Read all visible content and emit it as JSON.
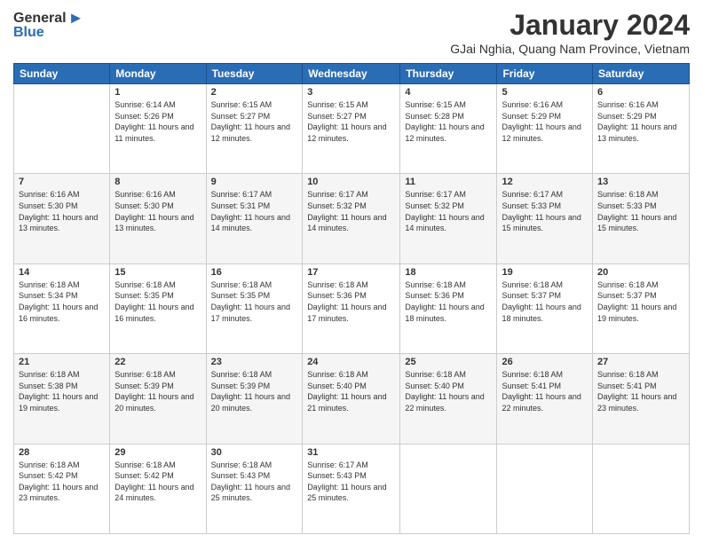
{
  "header": {
    "logo": {
      "general": "General",
      "blue": "Blue",
      "arrow": "▶"
    },
    "title": "January 2024",
    "location": "GJai Nghia, Quang Nam Province, Vietnam"
  },
  "weekdays": [
    "Sunday",
    "Monday",
    "Tuesday",
    "Wednesday",
    "Thursday",
    "Friday",
    "Saturday"
  ],
  "weeks": [
    [
      {
        "day": "",
        "sunrise": "",
        "sunset": "",
        "daylight": ""
      },
      {
        "day": "1",
        "sunrise": "Sunrise: 6:14 AM",
        "sunset": "Sunset: 5:26 PM",
        "daylight": "Daylight: 11 hours and 11 minutes."
      },
      {
        "day": "2",
        "sunrise": "Sunrise: 6:15 AM",
        "sunset": "Sunset: 5:27 PM",
        "daylight": "Daylight: 11 hours and 12 minutes."
      },
      {
        "day": "3",
        "sunrise": "Sunrise: 6:15 AM",
        "sunset": "Sunset: 5:27 PM",
        "daylight": "Daylight: 11 hours and 12 minutes."
      },
      {
        "day": "4",
        "sunrise": "Sunrise: 6:15 AM",
        "sunset": "Sunset: 5:28 PM",
        "daylight": "Daylight: 11 hours and 12 minutes."
      },
      {
        "day": "5",
        "sunrise": "Sunrise: 6:16 AM",
        "sunset": "Sunset: 5:29 PM",
        "daylight": "Daylight: 11 hours and 12 minutes."
      },
      {
        "day": "6",
        "sunrise": "Sunrise: 6:16 AM",
        "sunset": "Sunset: 5:29 PM",
        "daylight": "Daylight: 11 hours and 13 minutes."
      }
    ],
    [
      {
        "day": "7",
        "sunrise": "Sunrise: 6:16 AM",
        "sunset": "Sunset: 5:30 PM",
        "daylight": "Daylight: 11 hours and 13 minutes."
      },
      {
        "day": "8",
        "sunrise": "Sunrise: 6:16 AM",
        "sunset": "Sunset: 5:30 PM",
        "daylight": "Daylight: 11 hours and 13 minutes."
      },
      {
        "day": "9",
        "sunrise": "Sunrise: 6:17 AM",
        "sunset": "Sunset: 5:31 PM",
        "daylight": "Daylight: 11 hours and 14 minutes."
      },
      {
        "day": "10",
        "sunrise": "Sunrise: 6:17 AM",
        "sunset": "Sunset: 5:32 PM",
        "daylight": "Daylight: 11 hours and 14 minutes."
      },
      {
        "day": "11",
        "sunrise": "Sunrise: 6:17 AM",
        "sunset": "Sunset: 5:32 PM",
        "daylight": "Daylight: 11 hours and 14 minutes."
      },
      {
        "day": "12",
        "sunrise": "Sunrise: 6:17 AM",
        "sunset": "Sunset: 5:33 PM",
        "daylight": "Daylight: 11 hours and 15 minutes."
      },
      {
        "day": "13",
        "sunrise": "Sunrise: 6:18 AM",
        "sunset": "Sunset: 5:33 PM",
        "daylight": "Daylight: 11 hours and 15 minutes."
      }
    ],
    [
      {
        "day": "14",
        "sunrise": "Sunrise: 6:18 AM",
        "sunset": "Sunset: 5:34 PM",
        "daylight": "Daylight: 11 hours and 16 minutes."
      },
      {
        "day": "15",
        "sunrise": "Sunrise: 6:18 AM",
        "sunset": "Sunset: 5:35 PM",
        "daylight": "Daylight: 11 hours and 16 minutes."
      },
      {
        "day": "16",
        "sunrise": "Sunrise: 6:18 AM",
        "sunset": "Sunset: 5:35 PM",
        "daylight": "Daylight: 11 hours and 17 minutes."
      },
      {
        "day": "17",
        "sunrise": "Sunrise: 6:18 AM",
        "sunset": "Sunset: 5:36 PM",
        "daylight": "Daylight: 11 hours and 17 minutes."
      },
      {
        "day": "18",
        "sunrise": "Sunrise: 6:18 AM",
        "sunset": "Sunset: 5:36 PM",
        "daylight": "Daylight: 11 hours and 18 minutes."
      },
      {
        "day": "19",
        "sunrise": "Sunrise: 6:18 AM",
        "sunset": "Sunset: 5:37 PM",
        "daylight": "Daylight: 11 hours and 18 minutes."
      },
      {
        "day": "20",
        "sunrise": "Sunrise: 6:18 AM",
        "sunset": "Sunset: 5:37 PM",
        "daylight": "Daylight: 11 hours and 19 minutes."
      }
    ],
    [
      {
        "day": "21",
        "sunrise": "Sunrise: 6:18 AM",
        "sunset": "Sunset: 5:38 PM",
        "daylight": "Daylight: 11 hours and 19 minutes."
      },
      {
        "day": "22",
        "sunrise": "Sunrise: 6:18 AM",
        "sunset": "Sunset: 5:39 PM",
        "daylight": "Daylight: 11 hours and 20 minutes."
      },
      {
        "day": "23",
        "sunrise": "Sunrise: 6:18 AM",
        "sunset": "Sunset: 5:39 PM",
        "daylight": "Daylight: 11 hours and 20 minutes."
      },
      {
        "day": "24",
        "sunrise": "Sunrise: 6:18 AM",
        "sunset": "Sunset: 5:40 PM",
        "daylight": "Daylight: 11 hours and 21 minutes."
      },
      {
        "day": "25",
        "sunrise": "Sunrise: 6:18 AM",
        "sunset": "Sunset: 5:40 PM",
        "daylight": "Daylight: 11 hours and 22 minutes."
      },
      {
        "day": "26",
        "sunrise": "Sunrise: 6:18 AM",
        "sunset": "Sunset: 5:41 PM",
        "daylight": "Daylight: 11 hours and 22 minutes."
      },
      {
        "day": "27",
        "sunrise": "Sunrise: 6:18 AM",
        "sunset": "Sunset: 5:41 PM",
        "daylight": "Daylight: 11 hours and 23 minutes."
      }
    ],
    [
      {
        "day": "28",
        "sunrise": "Sunrise: 6:18 AM",
        "sunset": "Sunset: 5:42 PM",
        "daylight": "Daylight: 11 hours and 23 minutes."
      },
      {
        "day": "29",
        "sunrise": "Sunrise: 6:18 AM",
        "sunset": "Sunset: 5:42 PM",
        "daylight": "Daylight: 11 hours and 24 minutes."
      },
      {
        "day": "30",
        "sunrise": "Sunrise: 6:18 AM",
        "sunset": "Sunset: 5:43 PM",
        "daylight": "Daylight: 11 hours and 25 minutes."
      },
      {
        "day": "31",
        "sunrise": "Sunrise: 6:17 AM",
        "sunset": "Sunset: 5:43 PM",
        "daylight": "Daylight: 11 hours and 25 minutes."
      },
      {
        "day": "",
        "sunrise": "",
        "sunset": "",
        "daylight": ""
      },
      {
        "day": "",
        "sunrise": "",
        "sunset": "",
        "daylight": ""
      },
      {
        "day": "",
        "sunrise": "",
        "sunset": "",
        "daylight": ""
      }
    ]
  ]
}
